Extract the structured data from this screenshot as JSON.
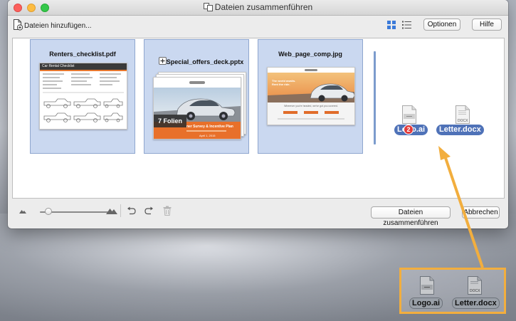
{
  "window": {
    "title": "Dateien zusammenführen"
  },
  "toolbar": {
    "add_files_label": "Dateien hinzufügen...",
    "options_label": "Optionen",
    "help_label": "Hilfe"
  },
  "files": {
    "pdf": {
      "name": "Renters_checklist.pdf",
      "page_title": "Car Rental Checklist"
    },
    "pptx": {
      "name": "Special_offers_deck.pptx",
      "slide_count_label": "7 Folien",
      "slide_heading": "ner Survey & Incentive Plan",
      "slide_date": "April 1, 2015"
    },
    "jpg": {
      "name": "Web_page_comp.jpg",
      "hero_text": "The world awaits. Rent the ride.",
      "sub_text": "Wherever you're headed, we've got you covered."
    }
  },
  "drag": {
    "logo_label": "Logo.ai",
    "letter_label": "Letter.docx",
    "docx_tag": "DOCX",
    "count_badge": "2"
  },
  "bottom": {
    "merge_label": "Dateien zusammenführen",
    "cancel_label": "Abbrechen",
    "zoom_level": 0.12
  },
  "colors": {
    "selection": "#cad8f0",
    "drag_pill": "#4f72b8",
    "callout_orange": "#f2ae3e",
    "view_active": "#3b7ad9"
  },
  "icons": {
    "add_files": "file-add-icon",
    "grid_view": "grid-view-icon",
    "list_view": "list-view-icon",
    "zoom_small": "mountain-small-icon",
    "zoom_large": "mountain-large-icon",
    "undo": "undo-icon",
    "redo": "redo-icon",
    "delete": "trash-icon"
  }
}
